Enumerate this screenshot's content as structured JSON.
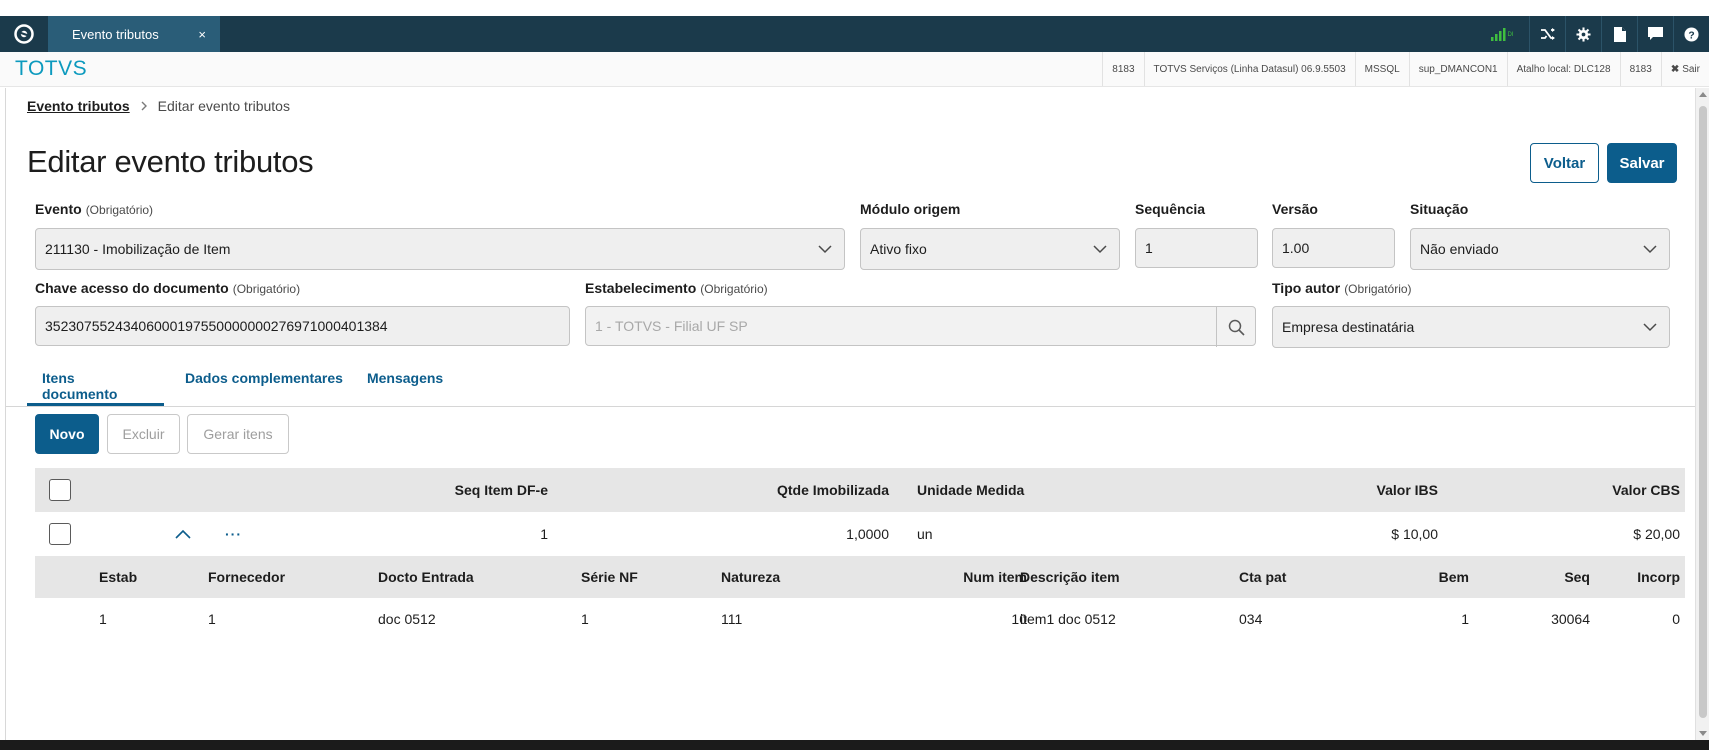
{
  "topbar": {
    "tab_title": "Evento tributos",
    "tab_close": "×",
    "tools": [
      "signal-icon",
      "shuffle-icon",
      "gear-icon",
      "document-icon",
      "chat-icon",
      "help-icon"
    ]
  },
  "header": {
    "brand": "TOTVS",
    "info": [
      "8183",
      "TOTVS Serviços (Linha Datasul) 06.9.5503",
      "MSSQL",
      "sup_DMANCON1",
      "Atalho local: DLC128",
      "8183"
    ],
    "logout": "Sair"
  },
  "breadcrumb": {
    "parent": "Evento tributos",
    "current": "Editar evento tributos"
  },
  "page_title": "Editar evento tributos",
  "actions": {
    "back": "Voltar",
    "save": "Salvar"
  },
  "form": {
    "evento": {
      "label": "Evento",
      "note": "(Obrigatório)",
      "value": "211130 - Imobilização de Item"
    },
    "modulo": {
      "label": "Módulo origem",
      "value": "Ativo fixo"
    },
    "sequencia": {
      "label": "Sequência",
      "value": "1"
    },
    "versao": {
      "label": "Versão",
      "value": "1.00"
    },
    "situacao": {
      "label": "Situação",
      "value": "Não enviado"
    },
    "chave": {
      "label": "Chave acesso do documento",
      "note": "(Obrigatório)",
      "value": "35230755243406000197550000000276971000401384"
    },
    "estabelecimento": {
      "label": "Estabelecimento",
      "note": "(Obrigatório)",
      "value": "1 - TOTVS - Filial UF SP"
    },
    "tipo_autor": {
      "label": "Tipo autor",
      "note": "(Obrigatório)",
      "value": "Empresa destinatária"
    }
  },
  "tabs": [
    "Itens documento",
    "Dados complementares",
    "Mensagens"
  ],
  "table_actions": {
    "new": "Novo",
    "delete": "Excluir",
    "generate": "Gerar itens"
  },
  "table": {
    "headers": {
      "seq": "Seq Item DF-e",
      "qtde": "Qtde Imobilizada",
      "unidade": "Unidade Medida",
      "ibs": "Valor IBS",
      "cbs": "Valor CBS"
    },
    "row": {
      "more": "···",
      "seq": "1",
      "qtde": "1,0000",
      "unidade": "un",
      "ibs": "$ 10,00",
      "cbs": "$ 20,00"
    }
  },
  "detail": {
    "headers": {
      "estab": "Estab",
      "fornecedor": "Fornecedor",
      "docto": "Docto Entrada",
      "serie": "Série NF",
      "natureza": "Natureza",
      "num_item": "Num item",
      "descricao": "Descrição item",
      "cta_pat": "Cta pat",
      "bem": "Bem",
      "seq": "Seq",
      "incorp": "Incorp"
    },
    "row": {
      "estab": "1",
      "fornecedor": "1",
      "docto": "doc 0512",
      "serie": "1",
      "natureza": "111",
      "num_item": "10",
      "descricao": "item1 doc 0512",
      "cta_pat": "034",
      "bem": "1",
      "seq": "30064",
      "incorp": "0"
    }
  }
}
